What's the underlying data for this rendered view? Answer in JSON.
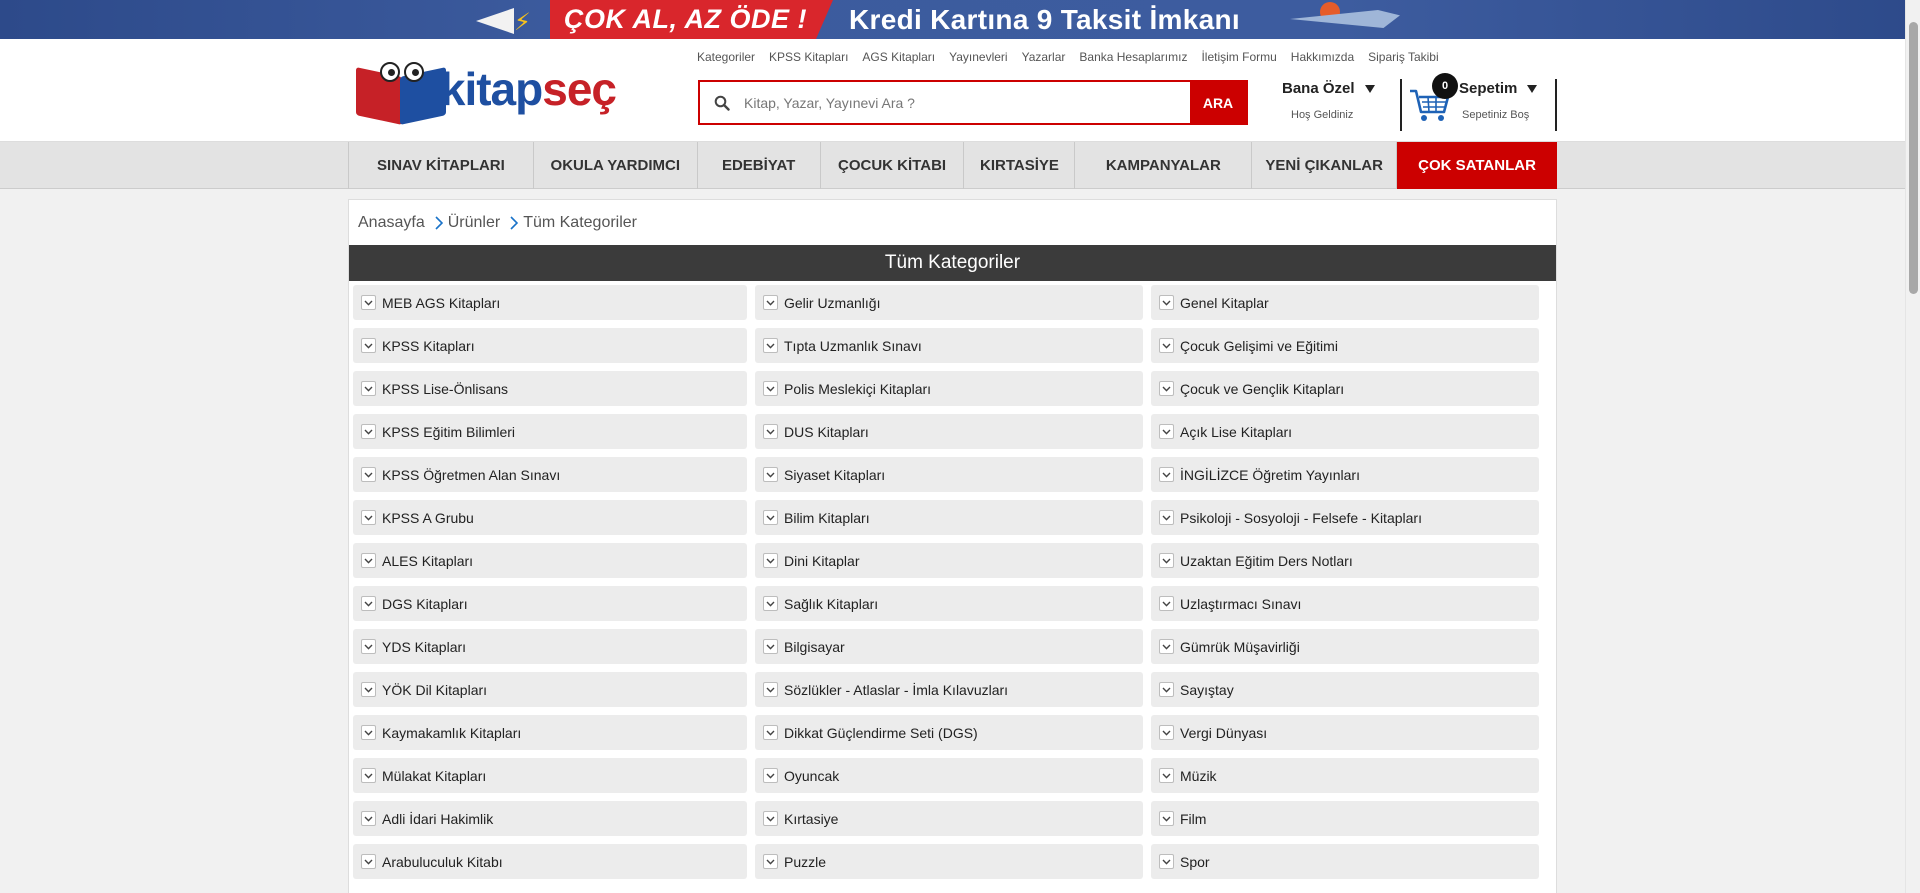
{
  "banner": {
    "left_text": "ÇOK AL, AZ ÖDE !",
    "right_text": "Kredi Kartına 9 Taksit İmkanı"
  },
  "logo": {
    "part1": "kitap",
    "part2": "seç"
  },
  "top_links": [
    "Kategoriler",
    "KPSS Kitapları",
    "AGS Kitapları",
    "Yayınevleri",
    "Yazarlar",
    "Banka Hesaplarımız",
    "İletişim Formu",
    "Hakkımızda",
    "Sipariş Takibi"
  ],
  "search": {
    "placeholder": "Kitap, Yazar, Yayınevi Ara ?",
    "button": "ARA"
  },
  "account": {
    "title": "Bana Özel",
    "subtitle": "Hoş Geldiniz"
  },
  "cart": {
    "title": "Sepetim",
    "subtitle": "Sepetiniz Boş",
    "count": "0"
  },
  "nav": [
    "SINAV KİTAPLARI",
    "OKULA YARDIMCI",
    "EDEBİYAT",
    "ÇOCUK KİTABI",
    "KIRTASİYE",
    "KAMPANYALAR",
    "YENİ ÇIKANLAR",
    "ÇOK SATANLAR"
  ],
  "breadcrumb": [
    "Anasayfa",
    "Ürünler",
    "Tüm Kategoriler"
  ],
  "section_title": "Tüm Kategoriler",
  "columns": [
    [
      "MEB AGS Kitapları",
      "KPSS Kitapları",
      "KPSS Lise-Önlisans",
      "KPSS Eğitim Bilimleri",
      "KPSS Öğretmen Alan Sınavı",
      "KPSS A Grubu",
      "ALES Kitapları",
      "DGS Kitapları",
      "YDS Kitapları",
      "YÖK Dil Kitapları",
      "Kaymakamlık Kitapları",
      "Mülakat Kitapları",
      "Adli İdari Hakimlik",
      "Arabuluculuk Kitabı"
    ],
    [
      "Gelir Uzmanlığı",
      "Tıpta Uzmanlık Sınavı",
      "Polis Meslekiçi Kitapları",
      "DUS Kitapları",
      "Siyaset Kitapları",
      "Bilim Kitapları",
      "Dini Kitaplar",
      "Sağlık Kitapları",
      "Bilgisayar",
      "Sözlükler - Atlaslar - İmla Kılavuzları",
      "Dikkat Güçlendirme Seti (DGS)",
      "Oyuncak",
      "Kırtasiye",
      "Puzzle"
    ],
    [
      "Genel Kitaplar",
      "Çocuk Gelişimi ve Eğitimi",
      "Çocuk ve Gençlik Kitapları",
      "Açık Lise Kitapları",
      "İNGİLİZCE Öğretim Yayınları",
      "Psikoloji - Sosyoloji - Felsefe - Kitapları",
      "Uzaktan Eğitim Ders Notları",
      "Uzlaştırmacı Sınavı",
      "Gümrük Müşavirliği",
      "Sayıştay",
      "Vergi Dünyası",
      "Müzik",
      "Film",
      "Spor"
    ]
  ]
}
